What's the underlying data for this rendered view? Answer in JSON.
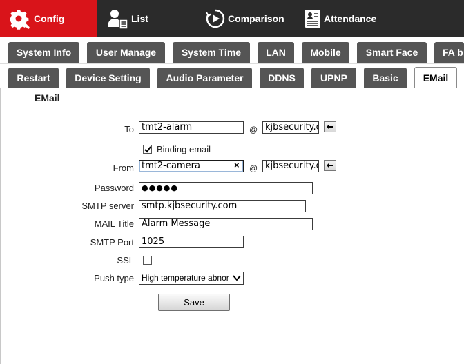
{
  "top_nav": {
    "config": "Config",
    "list": "List",
    "comparison": "Comparison",
    "attendance": "Attendance"
  },
  "tabs_row1": [
    "System Info",
    "User Manage",
    "System Time",
    "LAN",
    "Mobile",
    "Smart Face",
    "FA b"
  ],
  "tabs_row2": [
    "Restart",
    "Device Setting",
    "Audio Parameter",
    "DDNS",
    "UPNP",
    "Basic",
    "EMail"
  ],
  "active_tab": "EMail",
  "section_title": "EMail",
  "form": {
    "to_label": "To",
    "to_user": "tmt2-alarm",
    "to_domain": "kjbsecurity.c",
    "at_symbol": "@",
    "binding_label": "Binding email",
    "binding_checked": true,
    "from_label": "From",
    "from_user": "tmt2-camera",
    "from_clear": "×",
    "from_domain": "kjbsecurity.c",
    "password_label": "Password",
    "password_value": "●●●●●",
    "smtp_server_label": "SMTP server",
    "smtp_server_value": "smtp.kjbsecurity.com",
    "mail_title_label": "MAIL Title",
    "mail_title_value": "Alarm Message",
    "smtp_port_label": "SMTP Port",
    "smtp_port_value": "1025",
    "ssl_label": "SSL",
    "ssl_checked": false,
    "push_type_label": "Push type",
    "push_type_value": "High temperature abnor",
    "save_label": "Save"
  },
  "colors": {
    "topbar": "#2b2b2b",
    "active_nav": "#d9141a",
    "tab": "#555555"
  }
}
